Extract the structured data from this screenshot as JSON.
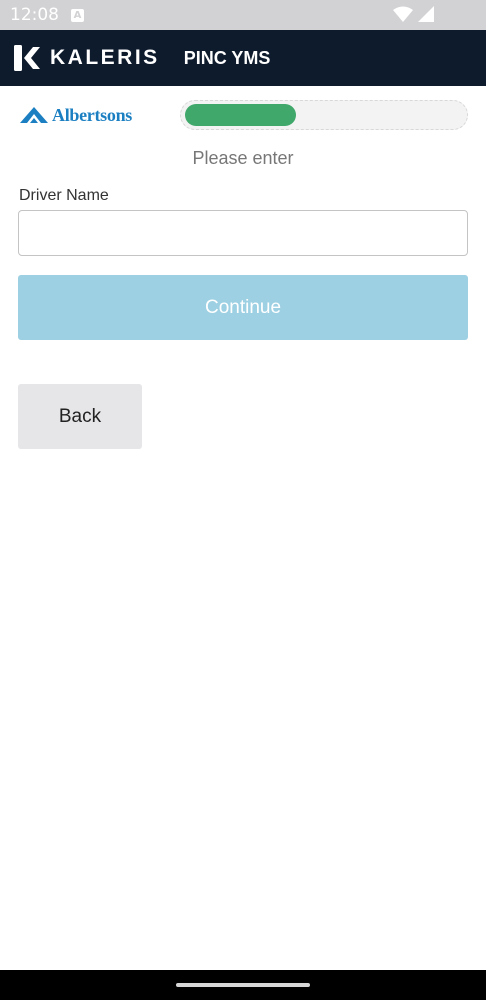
{
  "status_bar": {
    "time": "12:08",
    "notification_glyph": "A",
    "icons": [
      "wifi-icon",
      "cell-signal-icon"
    ]
  },
  "header": {
    "brand_name": "KALERIS",
    "app_name": "PINC YMS",
    "background_color": "#0e1b2d"
  },
  "client": {
    "logo_text": "Albertsons",
    "logo_color": "#1b7fc2"
  },
  "progress": {
    "fraction": 0.4,
    "fill_color": "#40a86a"
  },
  "form": {
    "prompt": "Please enter",
    "field_label": "Driver Name",
    "field_value": "",
    "field_placeholder": "",
    "continue_label": "Continue",
    "back_label": "Back",
    "continue_color": "#9dd0e3",
    "back_color": "#e6e5e8"
  }
}
